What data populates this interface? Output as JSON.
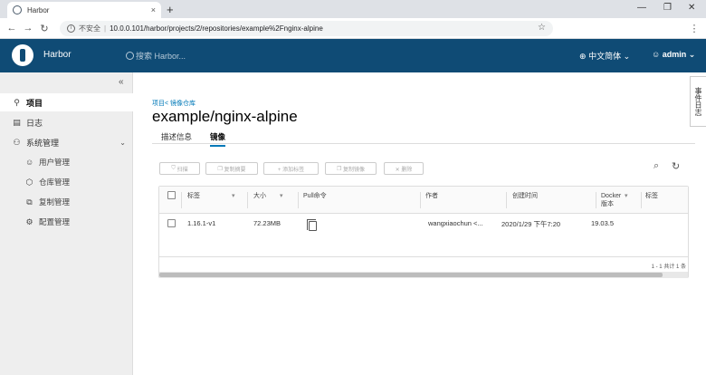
{
  "browser": {
    "tab_title": "Harbor",
    "tab_close": "×",
    "new_tab": "+",
    "win_min": "—",
    "win_max": "❐",
    "win_close": "✕",
    "insecure_label": "不安全",
    "url": "10.0.0.101/harbor/projects/2/repositories/example%2Fnginx-alpine"
  },
  "header": {
    "brand": "Harbor",
    "search_placeholder": "搜索 Harbor...",
    "language": "中文简体",
    "user": "admin"
  },
  "sidebar": {
    "collapse_icon": "«",
    "items": [
      {
        "label": "项目",
        "icon": "projects-icon"
      },
      {
        "label": "日志",
        "icon": "logs-icon"
      },
      {
        "label": "系统管理",
        "icon": "admin-icon"
      }
    ],
    "sub_items": [
      {
        "label": "用户管理",
        "icon": "users-icon"
      },
      {
        "label": "仓库管理",
        "icon": "registry-icon"
      },
      {
        "label": "复制管理",
        "icon": "replication-icon"
      },
      {
        "label": "配置管理",
        "icon": "config-icon"
      }
    ]
  },
  "main": {
    "breadcrumb": "项目< 镜像仓库",
    "title": "example/nginx-alpine",
    "tabs": [
      "描述信息",
      "镜像"
    ],
    "active_tab": "镜像",
    "toolbar": {
      "scan": "扫描",
      "copy_digest": "复制摘要",
      "add_label": "+ 添加标签",
      "retag": "复制镜像",
      "delete": "✕ 删除"
    },
    "table": {
      "headers": {
        "tag": "标签",
        "size": "大小",
        "pull_command": "Pull命令",
        "author": "作者",
        "created": "创建时间",
        "docker_version": "Docker 版本",
        "labels": "标签"
      },
      "rows": [
        {
          "tag": "1.16.1-v1",
          "size": "72.23MB",
          "author": "wangxiaochun <...",
          "created": "2020/1/29 下午7:20",
          "docker_version": "19.03.5"
        }
      ],
      "pager": "1 - 1 共计 1 条"
    }
  },
  "event_log": "事件日志",
  "colors": {
    "header_bg": "#0f4b75",
    "accent": "#0079b8",
    "sidebar_bg": "#eeeeee"
  }
}
